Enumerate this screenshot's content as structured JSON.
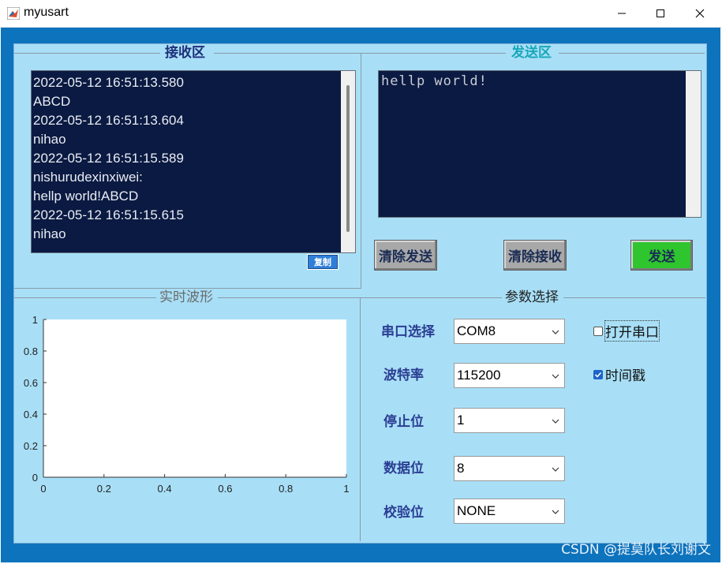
{
  "window": {
    "title": "myusart"
  },
  "receive": {
    "title": "接收区",
    "lines": [
      "2022-05-12 16:51:13.580",
      "ABCD",
      "2022-05-12 16:51:13.604",
      "nihao",
      "2022-05-12 16:51:15.589",
      "nishurudexinxiwei:",
      "hellp world!ABCD",
      "2022-05-12 16:51:15.615",
      "nihao"
    ],
    "copy_label": "复制"
  },
  "send": {
    "title": "发送区",
    "text": "hellp world!",
    "clear_send_label": "清除发送",
    "clear_receive_label": "清除接收",
    "send_label": "发送"
  },
  "waveform": {
    "title": "实时波形",
    "chart_data": {
      "type": "line",
      "series": [],
      "xlim": [
        0,
        1
      ],
      "ylim": [
        0,
        1
      ],
      "x_ticks": [
        "0",
        "0.2",
        "0.4",
        "0.6",
        "0.8",
        "1"
      ],
      "y_ticks": [
        "0",
        "0.2",
        "0.4",
        "0.6",
        "0.8",
        "1"
      ],
      "grid": false
    }
  },
  "params": {
    "title": "参数选择",
    "port_label": "串口选择",
    "port_value": "COM8",
    "baud_label": "波特率",
    "baud_value": "115200",
    "stop_label": "停止位",
    "stop_value": "1",
    "data_label": "数据位",
    "data_value": "8",
    "parity_label": "校验位",
    "parity_value": "NONE",
    "open_port_label": "打开串口",
    "open_port_checked": false,
    "timestamp_label": "时间戳",
    "timestamp_checked": true
  },
  "watermark": "CSDN @提莫队长刘谢文",
  "colors": {
    "frame": "#0d73bd",
    "panel": "#a8dff7",
    "textbox": "#0b1a42",
    "send_button": "#2ec52e"
  }
}
